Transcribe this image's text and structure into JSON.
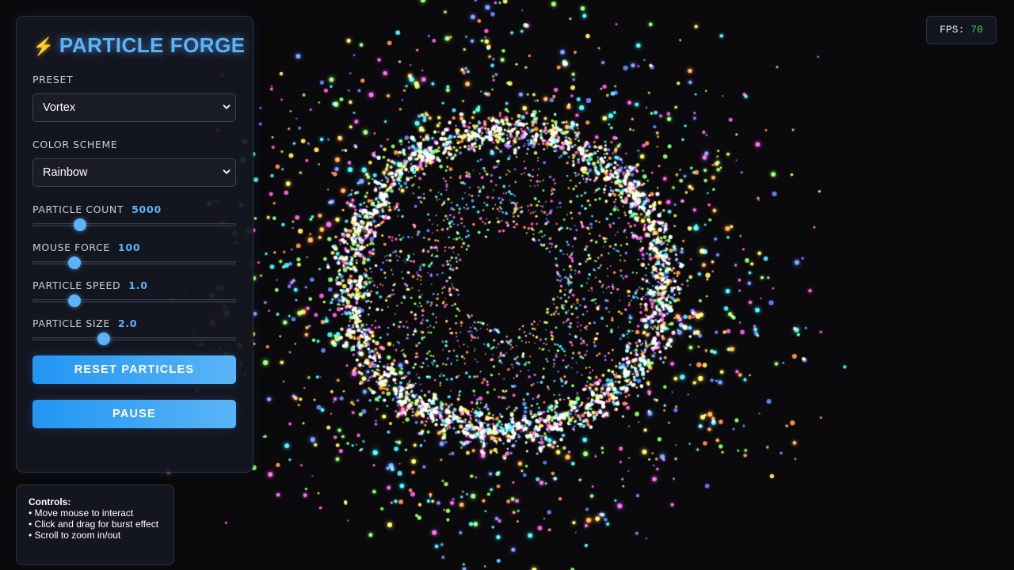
{
  "app": {
    "title": "PARTICLE FORGE",
    "title_icon": "lightning-bolt-icon",
    "accent_color": "#5ab4f7"
  },
  "controls": {
    "preset": {
      "label": "PRESET",
      "selected": "Vortex"
    },
    "color_scheme": {
      "label": "COLOR SCHEME",
      "selected": "Rainbow"
    },
    "sliders": [
      {
        "key": "particle_count",
        "label": "PARTICLE COUNT",
        "value": "5000",
        "level": 0.23
      },
      {
        "key": "mouse_force",
        "label": "MOUSE FORCE",
        "value": "100",
        "level": 0.205
      },
      {
        "key": "particle_speed",
        "label": "PARTICLE SPEED",
        "value": "1.0",
        "level": 0.205
      },
      {
        "key": "particle_size",
        "label": "PARTICLE SIZE",
        "value": "2.0",
        "level": 0.35
      }
    ],
    "reset_label": "RESET PARTICLES",
    "pause_label": "PAUSE"
  },
  "help": {
    "title": "Controls:",
    "lines": [
      "• Move mouse to interact",
      "• Click and drag for burst effect",
      "• Scroll to zoom in/out"
    ]
  },
  "fps": {
    "label": "FPS:",
    "value": "70"
  },
  "visual": {
    "effect": "vortex ring of glowing particles",
    "colors": [
      "#ff4fd8",
      "#37e6ff",
      "#7dff5a",
      "#ffe14a",
      "#ff8a3a",
      "#5a78ff",
      "#ffffff"
    ]
  }
}
